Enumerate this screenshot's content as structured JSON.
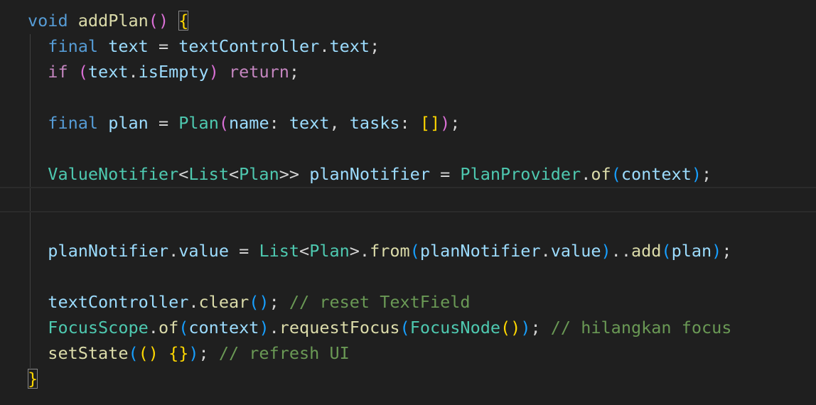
{
  "editor": {
    "language": "dart",
    "current_line_index": 7,
    "lines": [
      [
        {
          "t": "void",
          "c": "kw-blue"
        },
        {
          "t": " ",
          "c": "plain"
        },
        {
          "t": "addPlan",
          "c": "fn"
        },
        {
          "t": "()",
          "c": "p2"
        },
        {
          "t": " ",
          "c": "plain"
        },
        {
          "t": "{",
          "c": "p1 match"
        }
      ],
      [
        {
          "t": "  ",
          "c": "plain"
        },
        {
          "t": "final",
          "c": "kw-blue"
        },
        {
          "t": " ",
          "c": "plain"
        },
        {
          "t": "text",
          "c": "var"
        },
        {
          "t": " = ",
          "c": "plain"
        },
        {
          "t": "textController",
          "c": "var"
        },
        {
          "t": ".",
          "c": "plain"
        },
        {
          "t": "text",
          "c": "var"
        },
        {
          "t": ";",
          "c": "plain"
        }
      ],
      [
        {
          "t": "  ",
          "c": "plain"
        },
        {
          "t": "if",
          "c": "kw-purple"
        },
        {
          "t": " ",
          "c": "plain"
        },
        {
          "t": "(",
          "c": "p2"
        },
        {
          "t": "text",
          "c": "var"
        },
        {
          "t": ".",
          "c": "plain"
        },
        {
          "t": "isEmpty",
          "c": "var"
        },
        {
          "t": ")",
          "c": "p2"
        },
        {
          "t": " ",
          "c": "plain"
        },
        {
          "t": "return",
          "c": "kw-purple"
        },
        {
          "t": ";",
          "c": "plain"
        }
      ],
      [],
      [
        {
          "t": "  ",
          "c": "plain"
        },
        {
          "t": "final",
          "c": "kw-blue"
        },
        {
          "t": " ",
          "c": "plain"
        },
        {
          "t": "plan",
          "c": "var"
        },
        {
          "t": " = ",
          "c": "plain"
        },
        {
          "t": "Plan",
          "c": "type"
        },
        {
          "t": "(",
          "c": "p2"
        },
        {
          "t": "name",
          "c": "var"
        },
        {
          "t": ": ",
          "c": "plain"
        },
        {
          "t": "text",
          "c": "var"
        },
        {
          "t": ", ",
          "c": "plain"
        },
        {
          "t": "tasks",
          "c": "var"
        },
        {
          "t": ": ",
          "c": "plain"
        },
        {
          "t": "[]",
          "c": "p1"
        },
        {
          "t": ")",
          "c": "p2"
        },
        {
          "t": ";",
          "c": "plain"
        }
      ],
      [],
      [
        {
          "t": "  ",
          "c": "plain"
        },
        {
          "t": "ValueNotifier",
          "c": "type"
        },
        {
          "t": "<",
          "c": "plain"
        },
        {
          "t": "List",
          "c": "type"
        },
        {
          "t": "<",
          "c": "plain"
        },
        {
          "t": "Plan",
          "c": "type"
        },
        {
          "t": ">> ",
          "c": "plain"
        },
        {
          "t": "planNotifier",
          "c": "var"
        },
        {
          "t": " = ",
          "c": "plain"
        },
        {
          "t": "PlanProvider",
          "c": "type"
        },
        {
          "t": ".",
          "c": "plain"
        },
        {
          "t": "of",
          "c": "fn"
        },
        {
          "t": "(",
          "c": "p3"
        },
        {
          "t": "context",
          "c": "var"
        },
        {
          "t": ")",
          "c": "p3"
        },
        {
          "t": ";",
          "c": "plain"
        }
      ],
      [],
      [],
      [
        {
          "t": "  ",
          "c": "plain"
        },
        {
          "t": "planNotifier",
          "c": "var"
        },
        {
          "t": ".",
          "c": "plain"
        },
        {
          "t": "value",
          "c": "var"
        },
        {
          "t": " = ",
          "c": "plain"
        },
        {
          "t": "List",
          "c": "type"
        },
        {
          "t": "<",
          "c": "plain"
        },
        {
          "t": "Plan",
          "c": "type"
        },
        {
          "t": ">.",
          "c": "plain"
        },
        {
          "t": "from",
          "c": "fn"
        },
        {
          "t": "(",
          "c": "p3"
        },
        {
          "t": "planNotifier",
          "c": "var"
        },
        {
          "t": ".",
          "c": "plain"
        },
        {
          "t": "value",
          "c": "var"
        },
        {
          "t": ")",
          "c": "p3"
        },
        {
          "t": "..",
          "c": "plain"
        },
        {
          "t": "add",
          "c": "fn"
        },
        {
          "t": "(",
          "c": "p3"
        },
        {
          "t": "plan",
          "c": "var"
        },
        {
          "t": ")",
          "c": "p3"
        },
        {
          "t": ";",
          "c": "plain"
        }
      ],
      [],
      [
        {
          "t": "  ",
          "c": "plain"
        },
        {
          "t": "textController",
          "c": "var"
        },
        {
          "t": ".",
          "c": "plain"
        },
        {
          "t": "clear",
          "c": "fn"
        },
        {
          "t": "()",
          "c": "p3"
        },
        {
          "t": "; ",
          "c": "plain"
        },
        {
          "t": "// reset TextField",
          "c": "comment"
        }
      ],
      [
        {
          "t": "  ",
          "c": "plain"
        },
        {
          "t": "FocusScope",
          "c": "type"
        },
        {
          "t": ".",
          "c": "plain"
        },
        {
          "t": "of",
          "c": "fn"
        },
        {
          "t": "(",
          "c": "p3"
        },
        {
          "t": "context",
          "c": "var"
        },
        {
          "t": ")",
          "c": "p3"
        },
        {
          "t": ".",
          "c": "plain"
        },
        {
          "t": "requestFocus",
          "c": "fn"
        },
        {
          "t": "(",
          "c": "p3"
        },
        {
          "t": "FocusNode",
          "c": "type"
        },
        {
          "t": "()",
          "c": "p1"
        },
        {
          "t": ")",
          "c": "p3"
        },
        {
          "t": "; ",
          "c": "plain"
        },
        {
          "t": "// hilangkan focus",
          "c": "comment"
        }
      ],
      [
        {
          "t": "  ",
          "c": "plain"
        },
        {
          "t": "setState",
          "c": "fn"
        },
        {
          "t": "(",
          "c": "p3"
        },
        {
          "t": "()",
          "c": "p1"
        },
        {
          "t": " ",
          "c": "plain"
        },
        {
          "t": "{}",
          "c": "p1"
        },
        {
          "t": ")",
          "c": "p3"
        },
        {
          "t": "; ",
          "c": "plain"
        },
        {
          "t": "// refresh UI",
          "c": "comment"
        }
      ],
      [
        {
          "t": "}",
          "c": "p1 match"
        }
      ]
    ]
  }
}
